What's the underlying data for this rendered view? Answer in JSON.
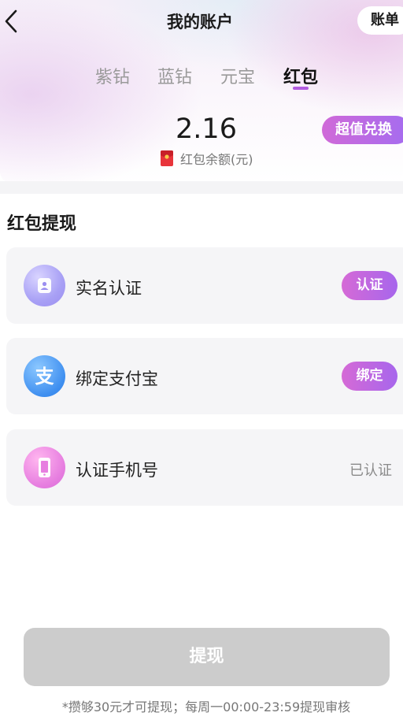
{
  "header": {
    "title": "我的账户",
    "bill_label": "账单"
  },
  "tabs": [
    {
      "label": "紫钻",
      "active": false
    },
    {
      "label": "蓝钻",
      "active": false
    },
    {
      "label": "元宝",
      "active": false
    },
    {
      "label": "红包",
      "active": true
    }
  ],
  "balance": {
    "amount": "2.16",
    "label": "红包余额(元)",
    "exchange_label": "超值兑换"
  },
  "withdraw_section": {
    "title": "红包提现",
    "items": [
      {
        "label": "实名认证",
        "action": "认证",
        "icon": "id-card-icon"
      },
      {
        "label": "绑定支付宝",
        "action": "绑定",
        "icon": "alipay-icon"
      },
      {
        "label": "认证手机号",
        "status": "已认证",
        "icon": "phone-icon"
      }
    ]
  },
  "withdraw_button": "提现",
  "footnote": "*攒够30元才可提现；每周一00:00-23:59提现审核",
  "colors": {
    "accent_start": "#d06ad8",
    "accent_end": "#a46cf0",
    "disabled_button": "#cccccc",
    "card_bg": "#f5f5f7"
  }
}
